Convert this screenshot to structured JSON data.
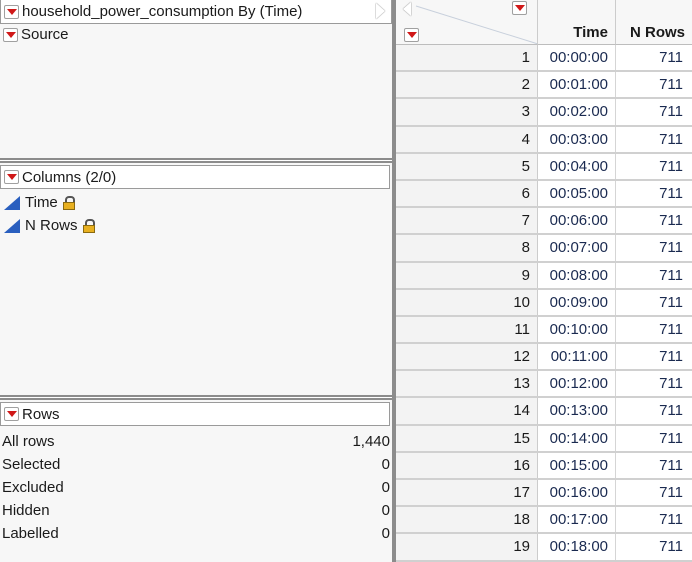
{
  "left_panel": {
    "title": "household_power_consumption By (Time)",
    "source_label": "Source",
    "columns_header": "Columns (2/0)",
    "columns": [
      {
        "name": "Time",
        "icon": "continuous-triangle-icon",
        "locked": true
      },
      {
        "name": "N Rows",
        "icon": "continuous-triangle-icon",
        "locked": true
      }
    ],
    "rows_header": "Rows",
    "row_stats": [
      {
        "label": "All rows",
        "value": "1,440"
      },
      {
        "label": "Selected",
        "value": "0"
      },
      {
        "label": "Excluded",
        "value": "0"
      },
      {
        "label": "Hidden",
        "value": "0"
      },
      {
        "label": "Labelled",
        "value": "0"
      }
    ]
  },
  "table": {
    "headers": [
      "Time",
      "N Rows"
    ],
    "rows": [
      {
        "n": "1",
        "time": "00:00:00",
        "count": "711"
      },
      {
        "n": "2",
        "time": "00:01:00",
        "count": "711"
      },
      {
        "n": "3",
        "time": "00:02:00",
        "count": "711"
      },
      {
        "n": "4",
        "time": "00:03:00",
        "count": "711"
      },
      {
        "n": "5",
        "time": "00:04:00",
        "count": "711"
      },
      {
        "n": "6",
        "time": "00:05:00",
        "count": "711"
      },
      {
        "n": "7",
        "time": "00:06:00",
        "count": "711"
      },
      {
        "n": "8",
        "time": "00:07:00",
        "count": "711"
      },
      {
        "n": "9",
        "time": "00:08:00",
        "count": "711"
      },
      {
        "n": "10",
        "time": "00:09:00",
        "count": "711"
      },
      {
        "n": "11",
        "time": "00:10:00",
        "count": "711"
      },
      {
        "n": "12",
        "time": "00:11:00",
        "count": "711"
      },
      {
        "n": "13",
        "time": "00:12:00",
        "count": "711"
      },
      {
        "n": "14",
        "time": "00:13:00",
        "count": "711"
      },
      {
        "n": "15",
        "time": "00:14:00",
        "count": "711"
      },
      {
        "n": "16",
        "time": "00:15:00",
        "count": "711"
      },
      {
        "n": "17",
        "time": "00:16:00",
        "count": "711"
      },
      {
        "n": "18",
        "time": "00:17:00",
        "count": "711"
      },
      {
        "n": "19",
        "time": "00:18:00",
        "count": "711"
      }
    ]
  }
}
